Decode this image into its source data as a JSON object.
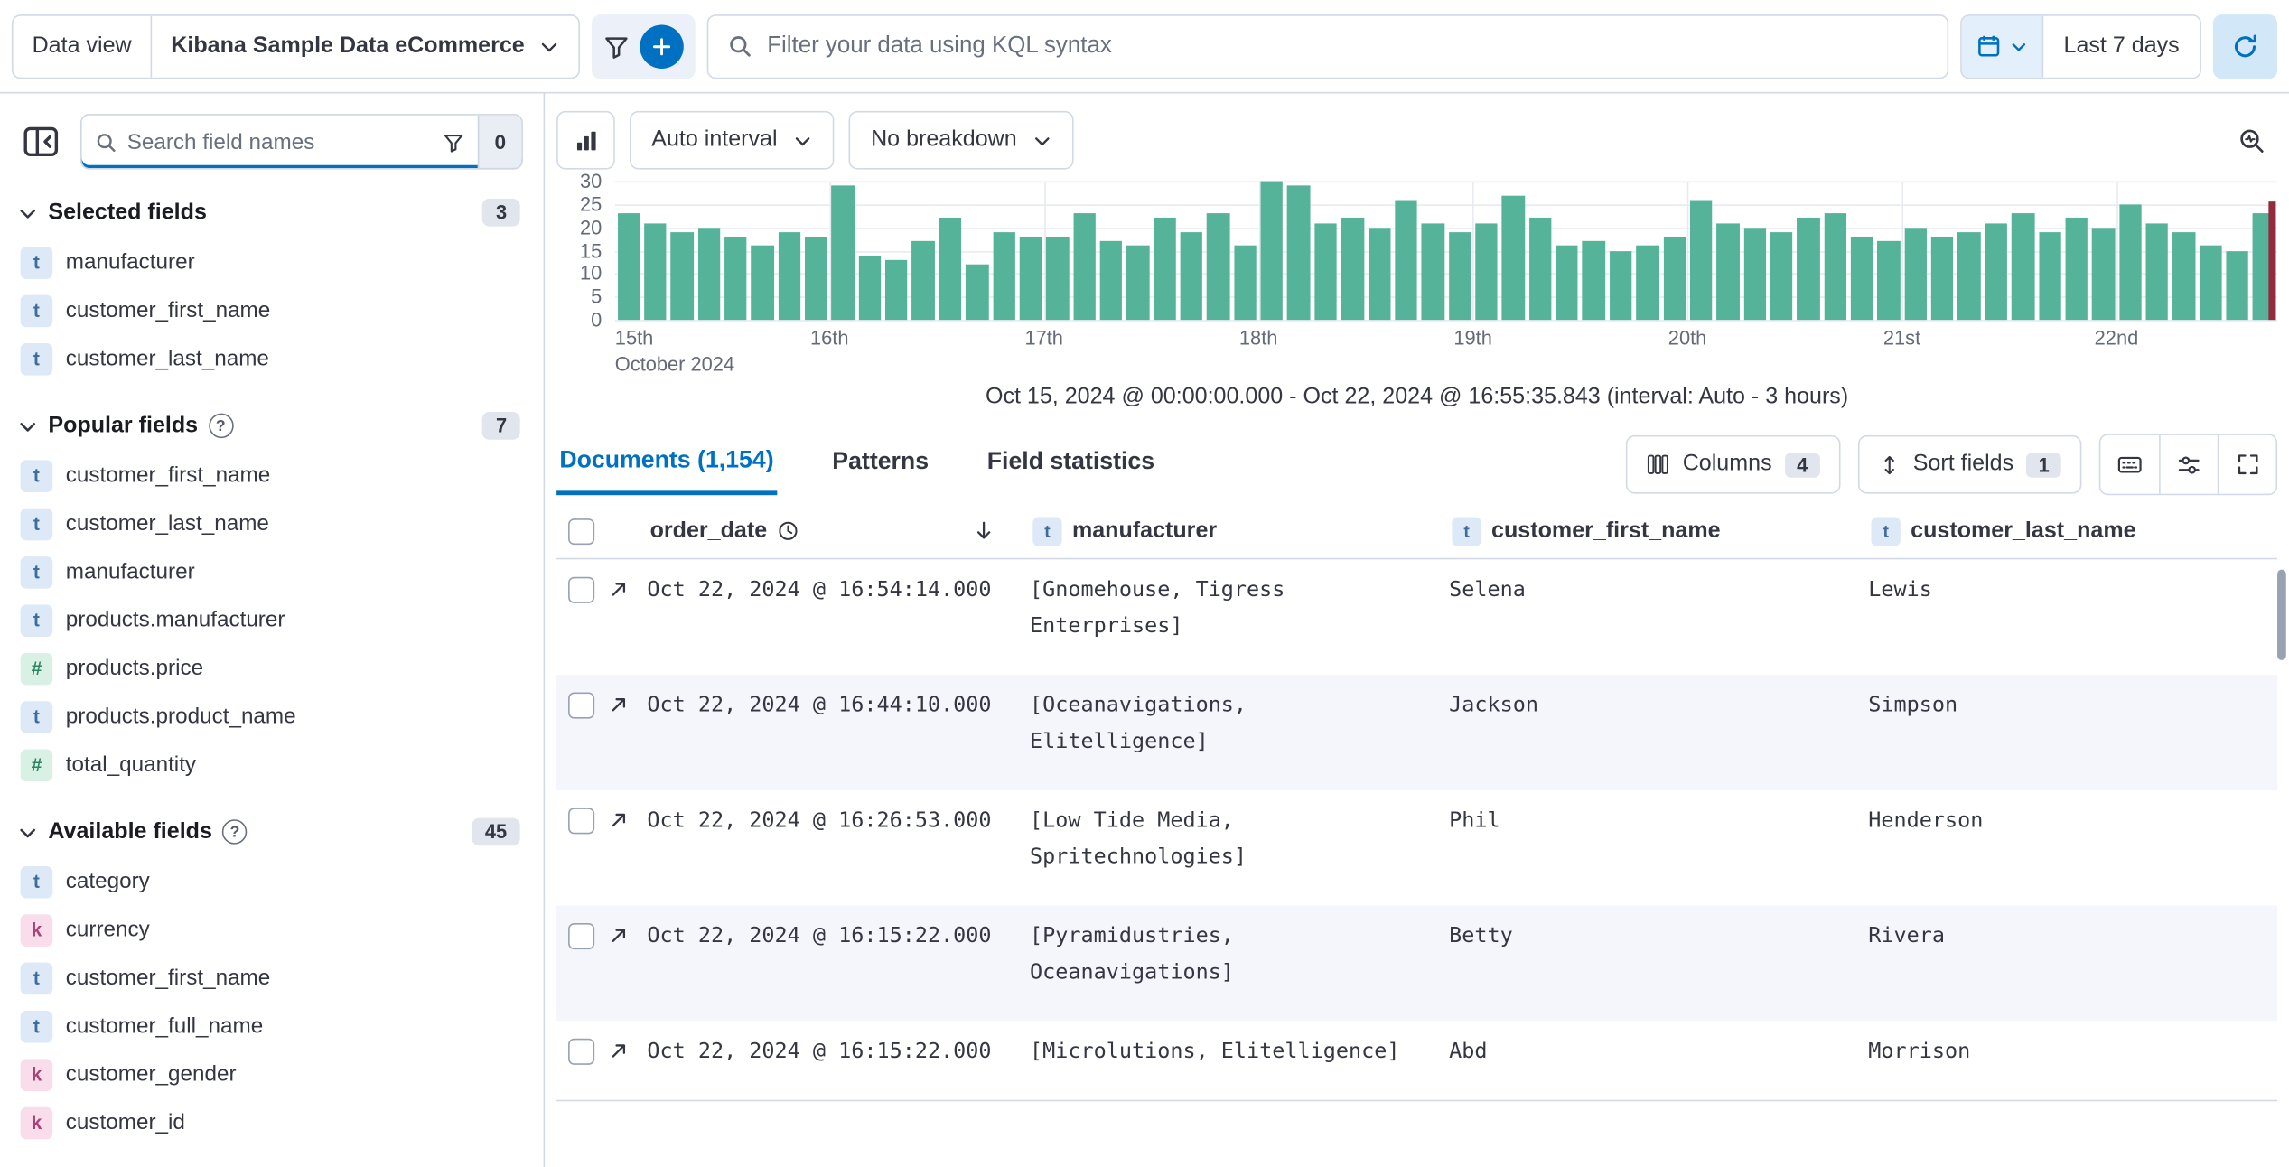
{
  "topbar": {
    "data_view_label": "Data view",
    "data_view_value": "Kibana Sample Data eCommerce",
    "kql_placeholder": "Filter your data using KQL syntax",
    "time_range": "Last 7 days"
  },
  "sidebar": {
    "search_placeholder": "Search field names",
    "filter_count": "0",
    "sections": [
      {
        "label": "Selected fields",
        "count": "3",
        "fields": [
          {
            "type": "t",
            "name": "manufacturer"
          },
          {
            "type": "t",
            "name": "customer_first_name"
          },
          {
            "type": "t",
            "name": "customer_last_name"
          }
        ]
      },
      {
        "label": "Popular fields",
        "count": "7",
        "fields": [
          {
            "type": "t",
            "name": "customer_first_name"
          },
          {
            "type": "t",
            "name": "customer_last_name"
          },
          {
            "type": "t",
            "name": "manufacturer"
          },
          {
            "type": "t",
            "name": "products.manufacturer"
          },
          {
            "type": "#",
            "name": "products.price"
          },
          {
            "type": "t",
            "name": "products.product_name"
          },
          {
            "type": "#",
            "name": "total_quantity"
          }
        ]
      },
      {
        "label": "Available fields",
        "count": "45",
        "fields": [
          {
            "type": "t",
            "name": "category"
          },
          {
            "type": "k",
            "name": "currency"
          },
          {
            "type": "t",
            "name": "customer_first_name"
          },
          {
            "type": "t",
            "name": "customer_full_name"
          },
          {
            "type": "k",
            "name": "customer_gender"
          },
          {
            "type": "k",
            "name": "customer_id"
          }
        ]
      }
    ]
  },
  "chart": {
    "interval_label": "Auto interval",
    "breakdown_label": "No breakdown",
    "caption": "Oct 15, 2024 @ 00:00:00.000 - Oct 22, 2024 @ 16:55:35.843 (interval: Auto - 3 hours)"
  },
  "chart_data": {
    "type": "bar",
    "title": "",
    "xlabel": "",
    "ylabel": "",
    "ylim": [
      0,
      30
    ],
    "y_ticks": [
      30,
      25,
      20,
      15,
      10,
      5,
      0
    ],
    "x_tick_labels": [
      "15th",
      "16th",
      "17th",
      "18th",
      "19th",
      "20th",
      "21st",
      "22nd"
    ],
    "x_sub_label": "October 2024",
    "bars_per_day": 8,
    "grid": true,
    "bar_color": "#54b399",
    "current_time_marker_color": "#922b3e",
    "values": [
      23,
      21,
      19,
      20,
      18,
      16,
      19,
      18,
      29,
      14,
      13,
      17,
      22,
      12,
      19,
      18,
      18,
      23,
      17,
      16,
      22,
      19,
      23,
      16,
      30,
      29,
      21,
      22,
      20,
      26,
      21,
      19,
      21,
      27,
      22,
      16,
      17,
      15,
      16,
      18,
      26,
      21,
      20,
      19,
      22,
      23,
      18,
      17,
      20,
      18,
      19,
      21,
      23,
      19,
      22,
      20,
      25,
      21,
      19,
      16,
      15,
      23
    ]
  },
  "tabs": [
    {
      "label": "Documents (1,154)"
    },
    {
      "label": "Patterns"
    },
    {
      "label": "Field statistics"
    }
  ],
  "toolbar": {
    "columns_label": "Columns",
    "columns_count": "4",
    "sort_label": "Sort fields",
    "sort_count": "1"
  },
  "table": {
    "headers": {
      "order_date": "order_date",
      "manufacturer": "manufacturer",
      "customer_first_name": "customer_first_name",
      "customer_last_name": "customer_last_name"
    },
    "type_icons": {
      "manufacturer": "t",
      "customer_first_name": "t",
      "customer_last_name": "t"
    },
    "rows": [
      {
        "order_date": "Oct 22, 2024 @ 16:54:14.000",
        "manufacturer": "[Gnomehouse, Tigress Enterprises]",
        "customer_first_name": "Selena",
        "customer_last_name": "Lewis"
      },
      {
        "order_date": "Oct 22, 2024 @ 16:44:10.000",
        "manufacturer": "[Oceanavigations, Elitelligence]",
        "customer_first_name": "Jackson",
        "customer_last_name": "Simpson"
      },
      {
        "order_date": "Oct 22, 2024 @ 16:26:53.000",
        "manufacturer": "[Low Tide Media, Spritechnologies]",
        "customer_first_name": "Phil",
        "customer_last_name": "Henderson"
      },
      {
        "order_date": "Oct 22, 2024 @ 16:15:22.000",
        "manufacturer": "[Pyramidustries, Oceanavigations]",
        "customer_first_name": "Betty",
        "customer_last_name": "Rivera"
      },
      {
        "order_date": "Oct 22, 2024 @ 16:15:22.000",
        "manufacturer": "[Microlutions, Elitelligence]",
        "customer_first_name": "Abd",
        "customer_last_name": "Morrison"
      }
    ]
  }
}
